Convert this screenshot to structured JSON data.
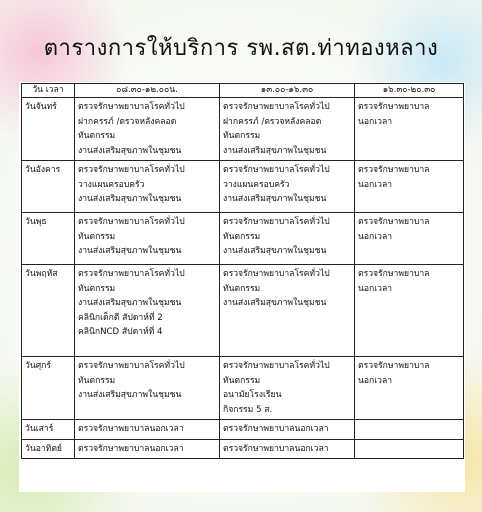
{
  "title": "ตารางการให้บริการ รพ.สต.ท่าทองหลาง",
  "header": {
    "day": "วัน เวลา",
    "morning": "๐๘.๓๐-๑๒.๐๐น.",
    "afternoon": "๑๓.๐๐-๑๖.๓๐",
    "evening": "๑๖.๓๐-๒๐.๓๐"
  },
  "rows": [
    {
      "day": "วันจันทร์",
      "morning": [
        "ตรวจรักษาพยาบาลโรคทั่วไป",
        "ฝากครรภ์ /ตรวจหลังคลอด",
        "ทันตกรรม",
        "งานส่งเสริมสุขภาพในชุมชน"
      ],
      "afternoon": [
        "ตรวจรักษาพยาบาลโรคทั่วไป",
        "ฝากครรภ์ /ตรวจหลังคลอด",
        "ทันตกรรม",
        "งานส่งเสริมสุขภาพในชุมชน"
      ],
      "evening": [
        "ตรวจรักษาพยาบาล",
        "นอกเวลา"
      ]
    },
    {
      "day": "วันอังคาร",
      "morning": [
        "ตรวจรักษาพยาบาลโรคทั่วไป",
        "วางแผนครอบครัว",
        "งานส่งเสริมสุขภาพในชุมชน"
      ],
      "afternoon": [
        "ตรวจรักษาพยาบาลโรคทั่วไป",
        "วางแผนครอบครัว",
        "งานส่งเสริมสุขภาพในชุมชน"
      ],
      "evening": [
        "ตรวจรักษาพยาบาล",
        "นอกเวลา"
      ]
    },
    {
      "day": "วันพุธ",
      "morning": [
        "ตรวจรักษาพยาบาลโรคทั่วไป",
        "ทันตกรรม",
        "งานส่งเสริมสุขภาพในชุมชน"
      ],
      "afternoon": [
        "ตรวจรักษาพยาบาลโรคทั่วไป",
        "ทันตกรรม",
        "งานส่งเสริมสุขภาพในชุมชน"
      ],
      "evening": [
        "ตรวจรักษาพยาบาล",
        "นอกเวลา"
      ]
    },
    {
      "day": "วันพฤหัส",
      "morning": [
        "ตรวจรักษาพยาบาลโรคทั่วไป",
        "ทันตกรรม",
        "งานส่งเสริมสุขภาพในชุมชน",
        "คลินิกเด็กดี สัปดาห์ที่ 2",
        "คลินิกNCD สัปดาห์ที่ 4"
      ],
      "afternoon": [
        "ตรวจรักษาพยาบาลโรคทั่วไป",
        "ทันตกรรม",
        "งานส่งเสริมสุขภาพในชุมชน"
      ],
      "evening": [
        "ตรวจรักษาพยาบาล",
        "นอกเวลา"
      ]
    },
    {
      "day": "วันศุกร์",
      "morning": [
        "ตรวจรักษาพยาบาลโรคทั่วไป",
        "ทันตกรรม",
        "งานส่งเสริมสุขภาพในชุมชน"
      ],
      "afternoon": [
        "ตรวจรักษาพยาบาลโรคทั่วไป",
        "ทันตกรรม",
        "อนามัยโรงเรียน",
        "กิจกรรม 5 ส."
      ],
      "evening": [
        "ตรวจรักษาพยาบาล",
        "นอกเวลา"
      ]
    },
    {
      "day": "วันเสาร์",
      "morning": [
        "ตรวจรักษาพยาบาลนอกเวลา"
      ],
      "afternoon": [
        "ตรวจรักษาพยาบาลนอกเวลา"
      ],
      "evening": []
    },
    {
      "day": "วันอาทิตย์",
      "morning": [
        "ตรวจรักษาพยาบาลนอกเวลา"
      ],
      "afternoon": [
        "ตรวจรักษาพยาบาลนอกเวลา"
      ],
      "evening": []
    }
  ]
}
